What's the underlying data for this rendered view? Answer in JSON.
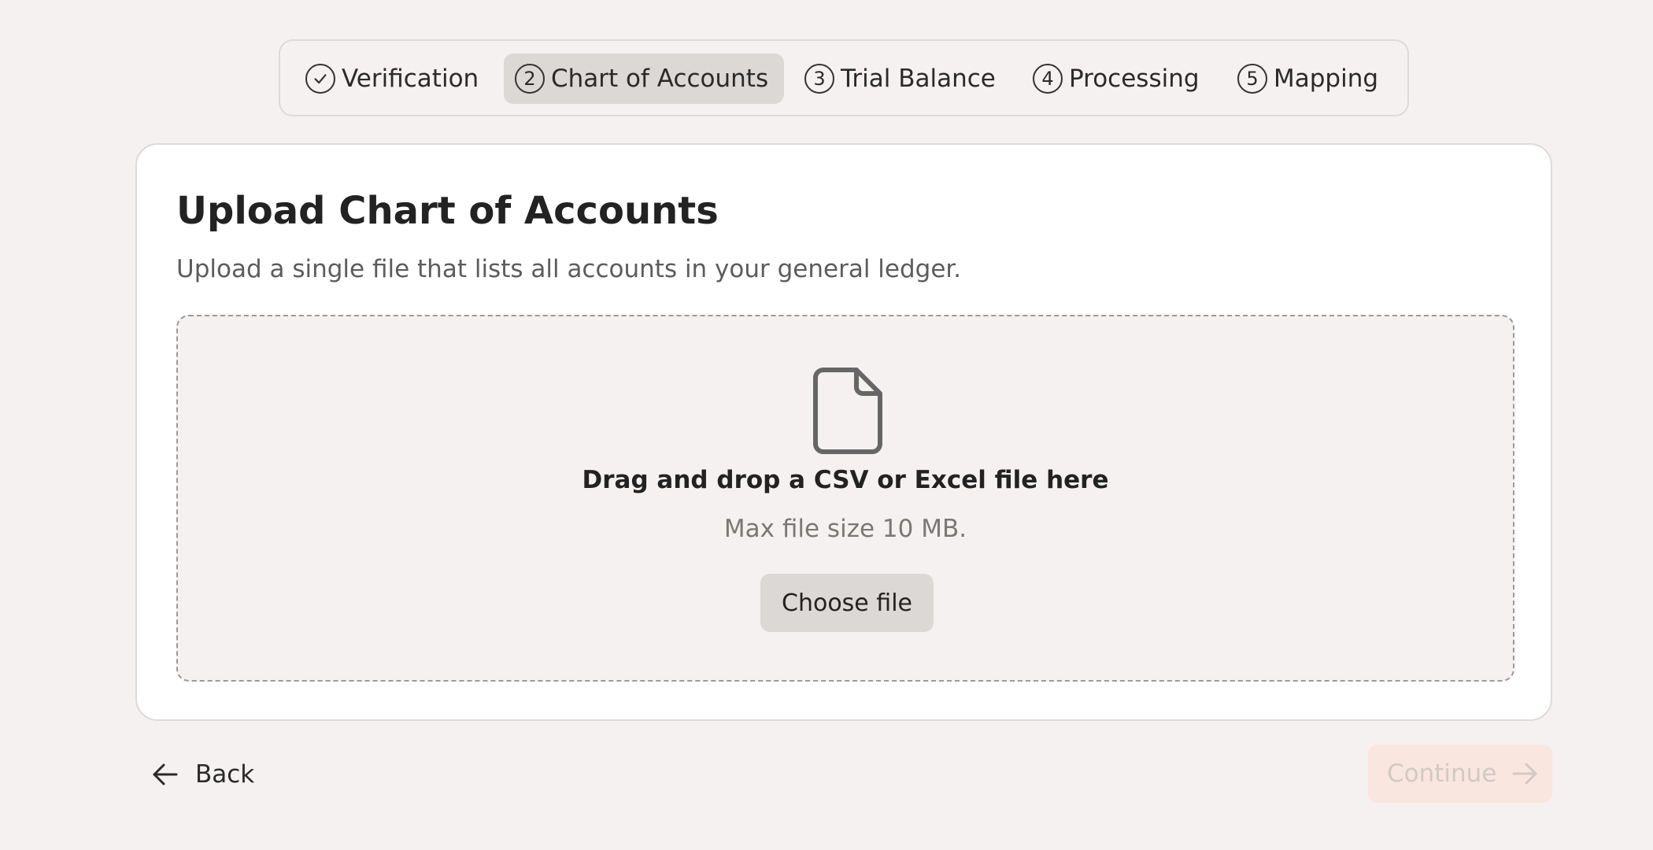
{
  "stepper": {
    "steps": [
      {
        "marker": "check-icon",
        "label": "Verification",
        "state": "completed"
      },
      {
        "marker": "2",
        "label": "Chart of Accounts",
        "state": "active"
      },
      {
        "marker": "3",
        "label": "Trial Balance",
        "state": "upcoming"
      },
      {
        "marker": "4",
        "label": "Processing",
        "state": "upcoming"
      },
      {
        "marker": "5",
        "label": "Mapping",
        "state": "upcoming"
      }
    ]
  },
  "card": {
    "title": "Upload Chart of Accounts",
    "subtitle": "Upload a single file that lists all accounts in your general ledger."
  },
  "dropzone": {
    "icon": "file-icon",
    "title": "Drag and drop a CSV or Excel file here",
    "hint": "Max file size 10 MB.",
    "button_label": "Choose file"
  },
  "footer": {
    "back_label": "Back",
    "back_icon": "arrow-left-icon",
    "continue_label": "Continue",
    "continue_icon": "arrow-right-icon",
    "continue_disabled": true
  },
  "colors": {
    "background": "#f5f1f0",
    "card": "#ffffff",
    "active_step": "#dcd8d6",
    "continue_disabled_bg": "#f9e6de",
    "continue_disabled_text": "#d2c9c5"
  }
}
